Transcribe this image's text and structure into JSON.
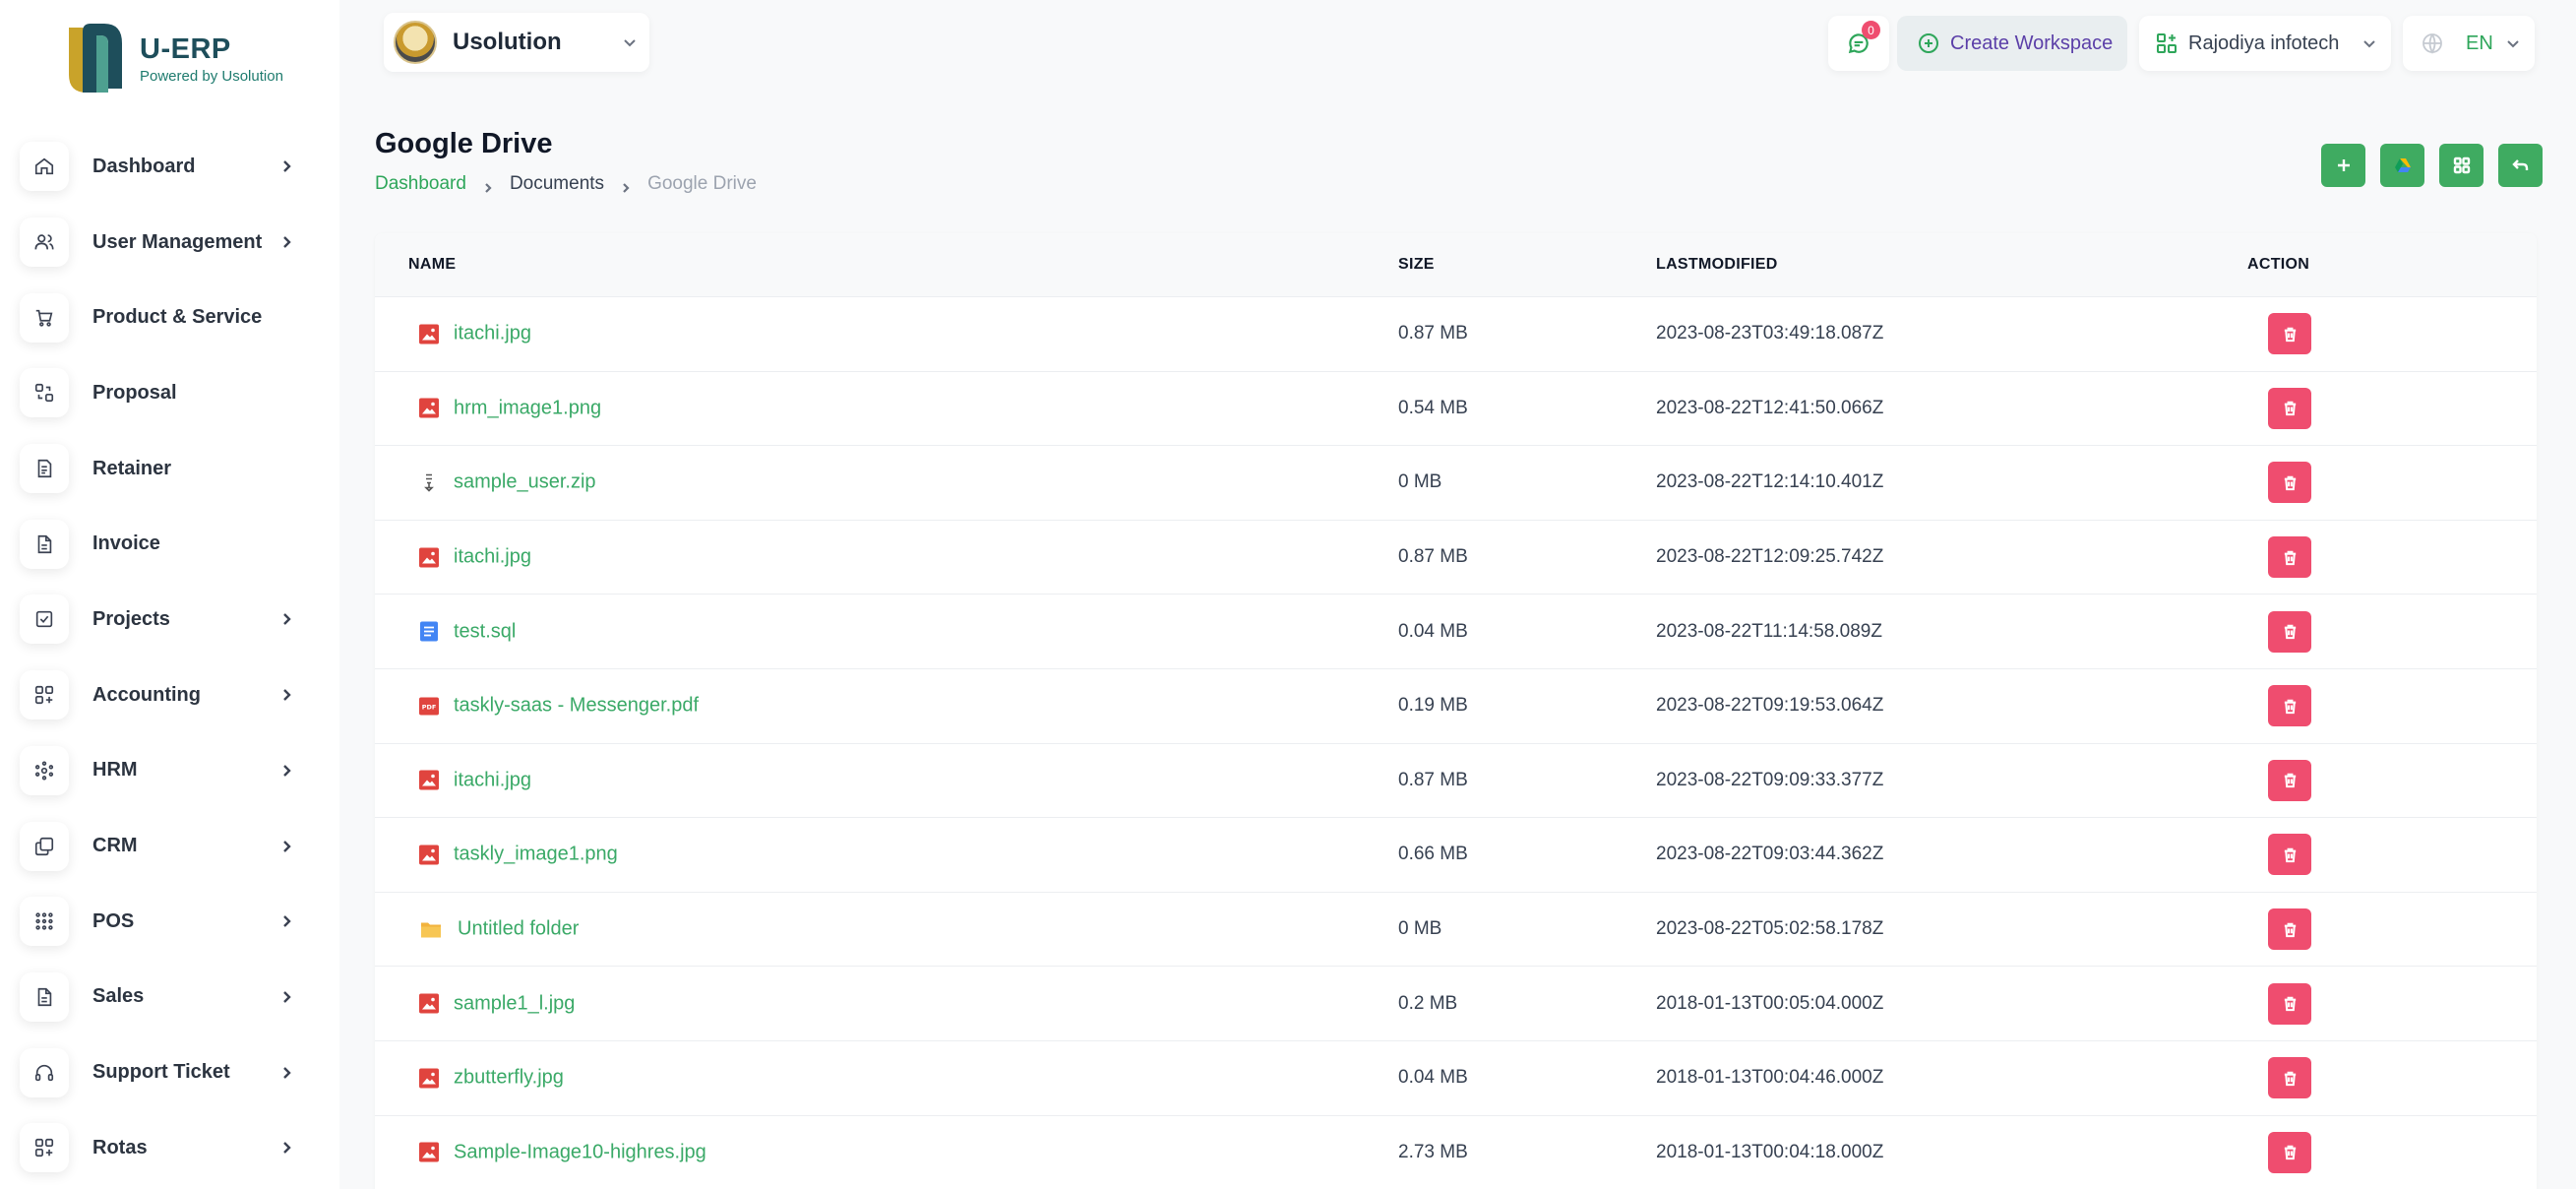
{
  "brand": {
    "name": "U-ERP",
    "tagline": "Powered by Usolution",
    "accent_color": "#2ea65a",
    "danger_color": "#ef4d6f"
  },
  "sidebar": {
    "items": [
      {
        "label": "Dashboard",
        "icon": "home-icon",
        "has_children": true
      },
      {
        "label": "User Management",
        "icon": "users-icon",
        "has_children": true
      },
      {
        "label": "Product & Service",
        "icon": "cart-icon",
        "has_children": false
      },
      {
        "label": "Proposal",
        "icon": "swap-icon",
        "has_children": false
      },
      {
        "label": "Retainer",
        "icon": "file-dollar-icon",
        "has_children": false
      },
      {
        "label": "Invoice",
        "icon": "document-icon",
        "has_children": false
      },
      {
        "label": "Projects",
        "icon": "checklist-icon",
        "has_children": true
      },
      {
        "label": "Accounting",
        "icon": "grid-plus-icon",
        "has_children": true
      },
      {
        "label": "HRM",
        "icon": "hrm-icon",
        "has_children": true
      },
      {
        "label": "CRM",
        "icon": "layers-icon",
        "has_children": true
      },
      {
        "label": "POS",
        "icon": "dots-grid-icon",
        "has_children": true
      },
      {
        "label": "Sales",
        "icon": "document-icon",
        "has_children": true
      },
      {
        "label": "Support Ticket",
        "icon": "headset-icon",
        "has_children": true
      },
      {
        "label": "Rotas",
        "icon": "grid-plus-icon",
        "has_children": true
      }
    ]
  },
  "header": {
    "workspace_name": "Usolution",
    "notification_count": "0",
    "create_workspace_label": "Create Workspace",
    "company_name": "Rajodiya infotech",
    "language": "EN"
  },
  "page": {
    "title": "Google Drive",
    "breadcrumb": [
      "Dashboard",
      "Documents",
      "Google Drive"
    ]
  },
  "table": {
    "columns": [
      "NAME",
      "SIZE",
      "LASTMODIFIED",
      "ACTION"
    ],
    "rows": [
      {
        "name": "itachi.jpg",
        "type": "image",
        "size": "0.87 MB",
        "modified": "2023-08-23T03:49:18.087Z"
      },
      {
        "name": "hrm_image1.png",
        "type": "image",
        "size": "0.54 MB",
        "modified": "2023-08-22T12:41:50.066Z"
      },
      {
        "name": "sample_user.zip",
        "type": "zip",
        "size": "0 MB",
        "modified": "2023-08-22T12:14:10.401Z"
      },
      {
        "name": "itachi.jpg",
        "type": "image",
        "size": "0.87 MB",
        "modified": "2023-08-22T12:09:25.742Z"
      },
      {
        "name": "test.sql",
        "type": "doc",
        "size": "0.04 MB",
        "modified": "2023-08-22T11:14:58.089Z"
      },
      {
        "name": "taskly-saas - Messenger.pdf",
        "type": "pdf",
        "size": "0.19 MB",
        "modified": "2023-08-22T09:19:53.064Z"
      },
      {
        "name": "itachi.jpg",
        "type": "image",
        "size": "0.87 MB",
        "modified": "2023-08-22T09:09:33.377Z"
      },
      {
        "name": "taskly_image1.png",
        "type": "image",
        "size": "0.66 MB",
        "modified": "2023-08-22T09:03:44.362Z"
      },
      {
        "name": "Untitled folder",
        "type": "folder",
        "size": "0 MB",
        "modified": "2023-08-22T05:02:58.178Z"
      },
      {
        "name": "sample1_l.jpg",
        "type": "image",
        "size": "0.2 MB",
        "modified": "2018-01-13T00:05:04.000Z"
      },
      {
        "name": "zbutterfly.jpg",
        "type": "image",
        "size": "0.04 MB",
        "modified": "2018-01-13T00:04:46.000Z"
      },
      {
        "name": "Sample-Image10-highres.jpg",
        "type": "image",
        "size": "2.73 MB",
        "modified": "2018-01-13T00:04:18.000Z"
      }
    ]
  }
}
